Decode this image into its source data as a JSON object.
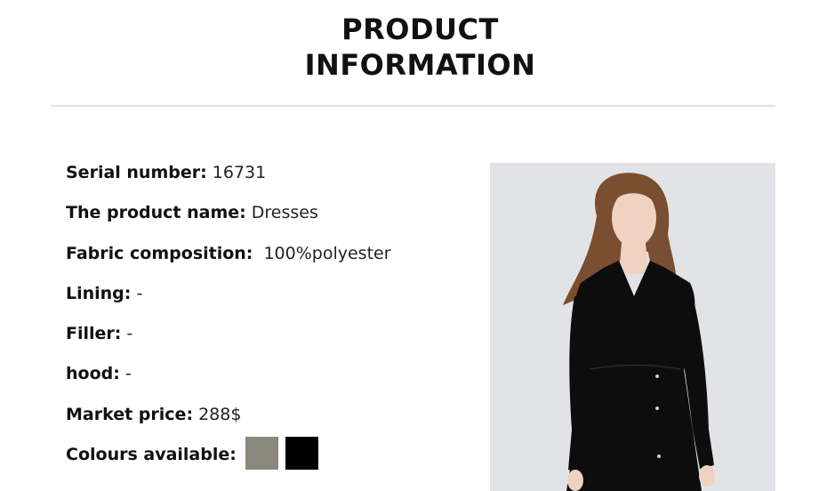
{
  "header": {
    "title_line1": "PRODUCT",
    "title_line2": "INFORMATION"
  },
  "product_info": {
    "serial_number": {
      "label": "Serial number:",
      "value": "16731"
    },
    "product_name": {
      "label": "The product name:",
      "value": "Dresses"
    },
    "fabric_composition": {
      "label": "Fabric composition:",
      "value": "100%polyester"
    },
    "lining": {
      "label": "Lining:",
      "value": "-"
    },
    "filler": {
      "label": "Filler:",
      "value": "-"
    },
    "hood": {
      "label": "hood:",
      "value": "-"
    },
    "market_price": {
      "label": "Market price:",
      "value": "288$"
    },
    "colours": {
      "label": "Colours available:",
      "swatches": [
        "#8a877c",
        "#000000"
      ]
    }
  },
  "photo": {
    "background": "#e2e3e6",
    "dress_color": "#0d0d0d",
    "hair_color": "#7a4e30",
    "skin_color": "#f0d2c2"
  }
}
